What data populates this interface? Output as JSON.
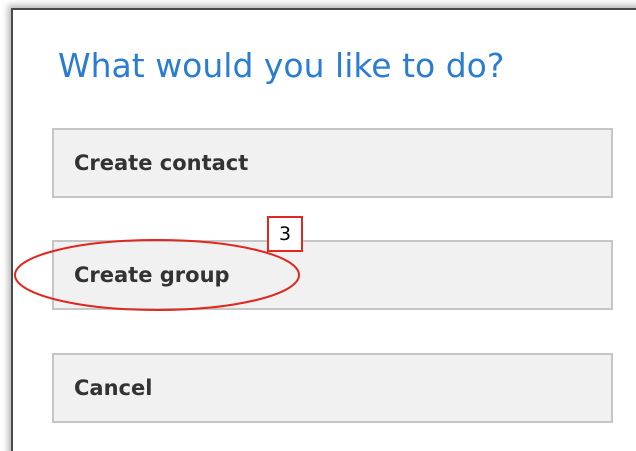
{
  "dialog": {
    "title": "What would you like to do?",
    "options": [
      {
        "label": "Create contact"
      },
      {
        "label": "Create group"
      },
      {
        "label": "Cancel"
      }
    ]
  },
  "annotation": {
    "step_number": "3",
    "highlight_color": "#e0281e",
    "highlighted_option": "Create group"
  },
  "colors": {
    "title": "#2b7cd3",
    "button_background": "#f1f1f1",
    "button_border": "#c6c6c6",
    "button_text": "#333333"
  }
}
